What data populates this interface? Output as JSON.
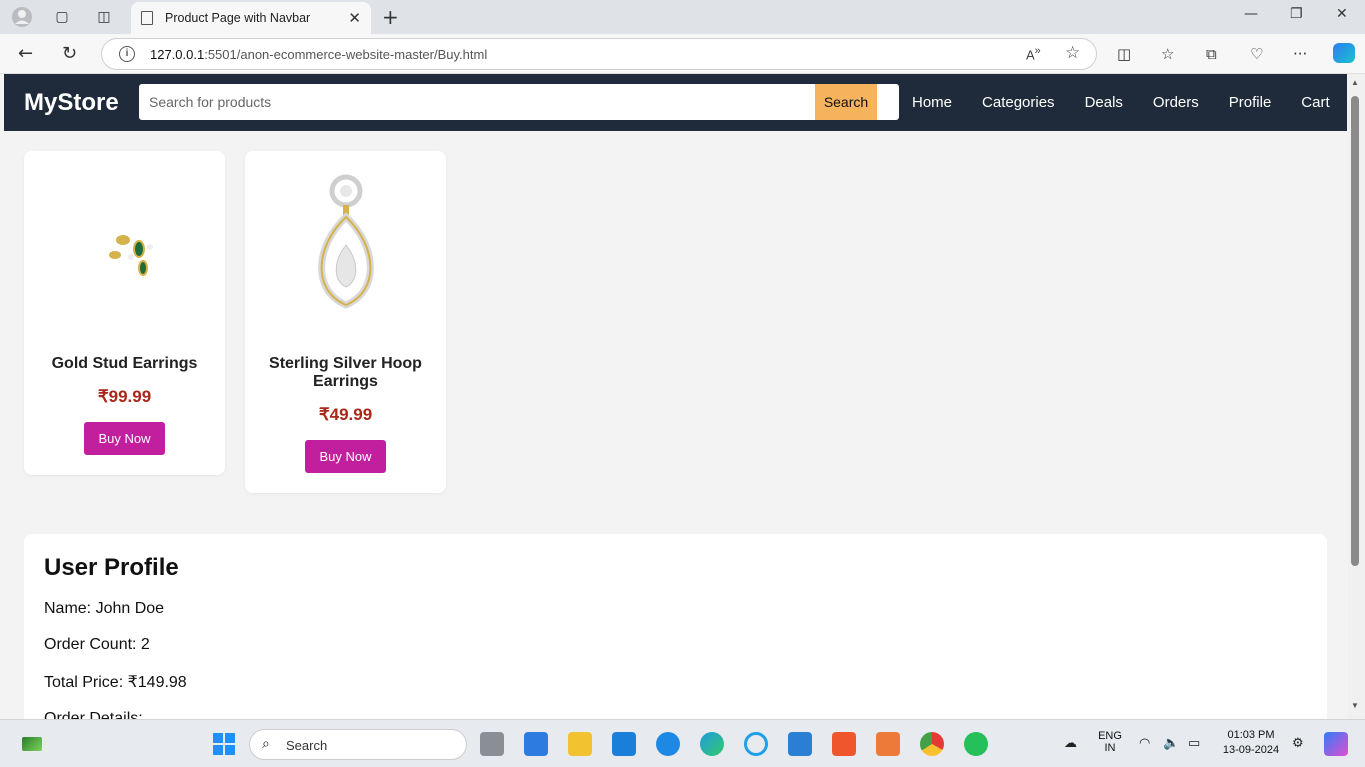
{
  "browser": {
    "tab_title": "Product Page with Navbar",
    "url_host": "127.0.0.1",
    "url_rest": ":5501/anon-ecommerce-website-master/Buy.html"
  },
  "navbar": {
    "brand": "MyStore",
    "search_placeholder": "Search for products",
    "search_button": "Search",
    "links": [
      "Home",
      "Categories",
      "Deals",
      "Orders",
      "Profile",
      "Cart"
    ]
  },
  "products": [
    {
      "name": "Gold Stud Earrings",
      "price": "₹99.99",
      "button": "Buy Now"
    },
    {
      "name": "Sterling Silver Hoop Earrings",
      "price": "₹49.99",
      "button": "Buy Now"
    }
  ],
  "profile": {
    "title": "User Profile",
    "name": "Name: John Doe",
    "order_count": "Order Count: 2",
    "total_price": "Total Price: ₹149.98",
    "order_details": "Order Details:"
  },
  "taskbar": {
    "search_label": "Search",
    "lang_1": "ENG",
    "lang_2": "IN",
    "time": "01:03 PM",
    "date": "13-09-2024"
  },
  "colors": {
    "navbar_bg": "#1f2b3a",
    "search_button": "#f4b35c",
    "buy_button": "#c21f9e",
    "price": "#a8281a"
  }
}
